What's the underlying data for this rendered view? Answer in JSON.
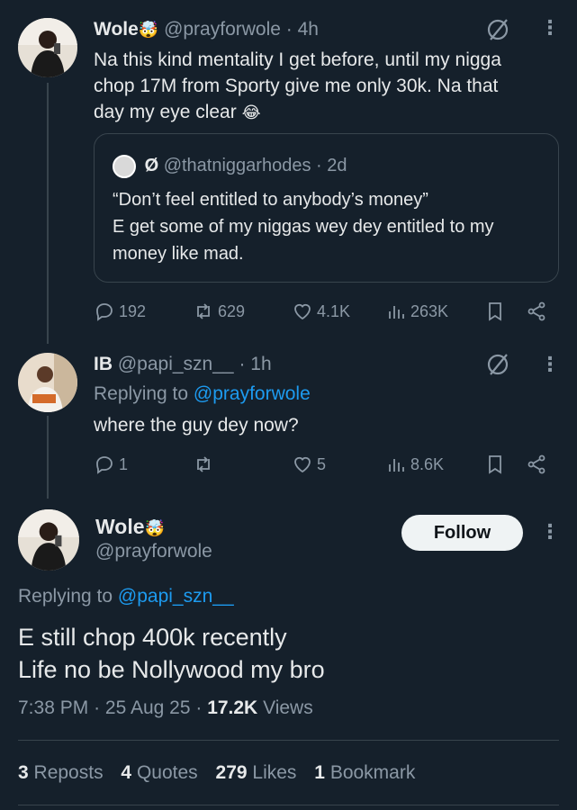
{
  "tweet1": {
    "name": "Wole",
    "name_emoji": "🤯",
    "handle": "@prayforwole",
    "time": "· 4h",
    "text_lines": [
      "Na this kind mentality I get before, until my nigga",
      "chop 17M from Sporty give me only 30k. Na that",
      "day my eye clear"
    ],
    "text_emoji": "😂",
    "quote": {
      "name_symbol": "Ø",
      "handle": "@thatniggarhodes",
      "time": "· 2d",
      "text_lines": [
        "“Don’t feel entitled to anybody’s money”",
        "E get some of my niggas wey dey entitled to my",
        "money like mad."
      ]
    },
    "replies": "192",
    "reposts": "629",
    "likes": "4.1K",
    "views": "263K"
  },
  "tweet2": {
    "name": "IB",
    "handle": "@papi_szn__",
    "time": "· 1h",
    "replying_prefix": "Replying to",
    "replying_handle": "@prayforwole",
    "text": "where the guy dey now?",
    "replies": "1",
    "reposts": "",
    "likes": "5",
    "views": "8.6K"
  },
  "main": {
    "name": "Wole",
    "name_emoji": "🤯",
    "handle": "@prayforwole",
    "follow_label": "Follow",
    "replying_prefix": "Replying to",
    "replying_handle": "@papi_szn__",
    "text_lines": [
      "E still chop 400k recently",
      "Life no be Nollywood my bro"
    ],
    "time": "7:38 PM",
    "date": "25 Aug 25",
    "views_count": "17.2K",
    "views_label": "Views",
    "reposts_count": "3",
    "reposts_label": "Reposts",
    "quotes_count": "4",
    "quotes_label": "Quotes",
    "likes_count": "279",
    "likes_label": "Likes",
    "bookmarks_count": "1",
    "bookmarks_label": "Bookmark"
  },
  "colors": {
    "background": "#15202b",
    "text": "#e7e9ea",
    "muted": "#8b98a5",
    "link": "#1d9bf0",
    "border": "#38444d"
  },
  "icons": [
    "grok-icon",
    "more-icon",
    "reply-icon",
    "repost-icon",
    "like-icon",
    "views-icon",
    "bookmark-icon",
    "share-icon"
  ]
}
